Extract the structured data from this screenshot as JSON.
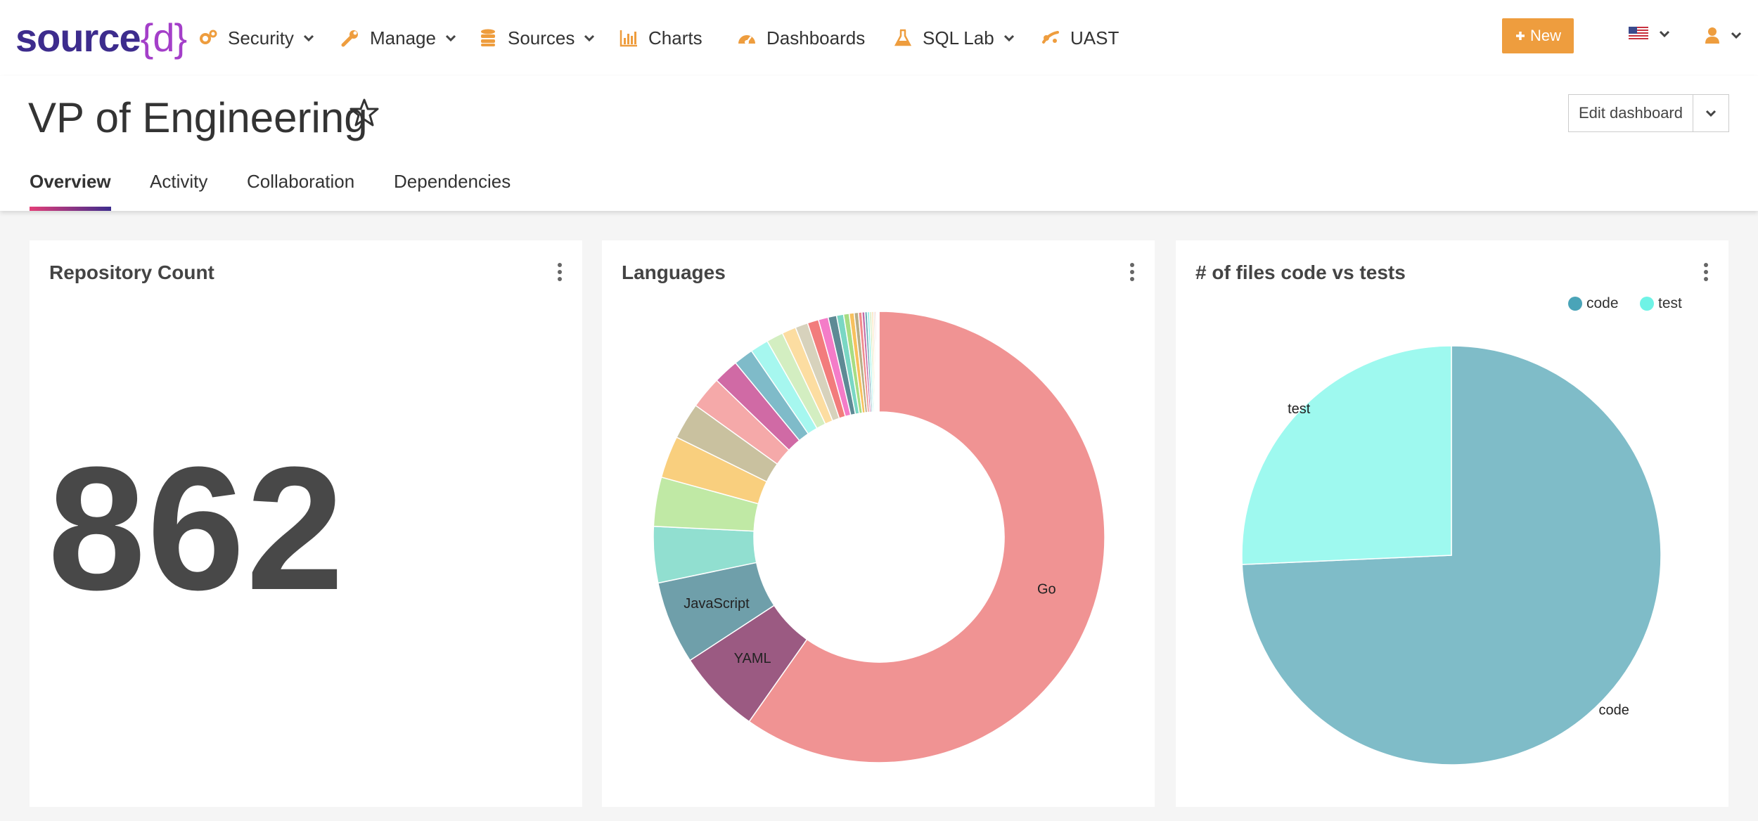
{
  "brand": {
    "logo_main": "source",
    "logo_left_brace": "{",
    "logo_letter": "d",
    "logo_right_brace": "}"
  },
  "nav": {
    "items": [
      {
        "label": "Security",
        "icon": "cogs-icon",
        "dropdown": true
      },
      {
        "label": "Manage",
        "icon": "wrench-icon",
        "dropdown": true
      },
      {
        "label": "Sources",
        "icon": "database-icon",
        "dropdown": true
      },
      {
        "label": "Charts",
        "icon": "bar-chart-icon",
        "dropdown": false
      },
      {
        "label": "Dashboards",
        "icon": "dashboard-gauge-icon",
        "dropdown": false
      },
      {
        "label": "SQL Lab",
        "icon": "flask-icon",
        "dropdown": true
      },
      {
        "label": "UAST",
        "icon": "tree-icon",
        "dropdown": false
      }
    ],
    "new_button": "New",
    "accent_color": "#ee9d3e"
  },
  "header": {
    "title": "VP of Engineering",
    "edit_button": "Edit dashboard",
    "tabs": [
      "Overview",
      "Activity",
      "Collaboration",
      "Dependencies"
    ],
    "active_tab": "Overview"
  },
  "cards": {
    "repo": {
      "title": "Repository Count",
      "value": "862"
    },
    "languages": {
      "title": "Languages"
    },
    "files": {
      "title": "# of files code vs tests"
    }
  },
  "chart_data": [
    {
      "type": "pie",
      "variant": "donut",
      "title": "Languages",
      "slices": [
        {
          "label": "Go",
          "value": 59.4,
          "color": "#f09393"
        },
        {
          "label": "YAML",
          "value": 6.0,
          "color": "#9b5a82"
        },
        {
          "label": "JavaScript",
          "value": 5.9,
          "color": "#6f9faa"
        },
        {
          "label": "",
          "value": 4.0,
          "color": "#91dfd0"
        },
        {
          "label": "",
          "value": 3.5,
          "color": "#c0e9a5"
        },
        {
          "label": "",
          "value": 3.0,
          "color": "#f9cf7e"
        },
        {
          "label": "",
          "value": 2.6,
          "color": "#c9c19f"
        },
        {
          "label": "",
          "value": 2.3,
          "color": "#f5a9a9"
        },
        {
          "label": "",
          "value": 1.8,
          "color": "#d06aa5"
        },
        {
          "label": "",
          "value": 1.4,
          "color": "#7fbbc9"
        },
        {
          "label": "",
          "value": 1.3,
          "color": "#a6f7ef"
        },
        {
          "label": "",
          "value": 1.2,
          "color": "#d3eec1"
        },
        {
          "label": "",
          "value": 1.0,
          "color": "#fcdda1"
        },
        {
          "label": "",
          "value": 0.9,
          "color": "#d7d2bc"
        },
        {
          "label": "",
          "value": 0.8,
          "color": "#f27c7c"
        },
        {
          "label": "",
          "value": 0.7,
          "color": "#f47cc8"
        },
        {
          "label": "",
          "value": 0.6,
          "color": "#5e8a95"
        },
        {
          "label": "",
          "value": 0.5,
          "color": "#7ad7c4"
        },
        {
          "label": "",
          "value": 0.4,
          "color": "#a7dd84"
        },
        {
          "label": "",
          "value": 0.35,
          "color": "#f7c15e"
        },
        {
          "label": "",
          "value": 0.3,
          "color": "#b8ae86"
        },
        {
          "label": "",
          "value": 0.25,
          "color": "#f08c8c"
        },
        {
          "label": "",
          "value": 0.2,
          "color": "#c26aa8"
        },
        {
          "label": "",
          "value": 0.18,
          "color": "#6fa8b8"
        },
        {
          "label": "",
          "value": 0.16,
          "color": "#8ff0e8"
        },
        {
          "label": "",
          "value": 0.14,
          "color": "#cde8b5"
        },
        {
          "label": "",
          "value": 0.12,
          "color": "#fbd18d"
        },
        {
          "label": "",
          "value": 0.1,
          "color": "#ccc6ad"
        },
        {
          "label": "",
          "value": 0.09,
          "color": "#e56c6c"
        },
        {
          "label": "",
          "value": 0.08,
          "color": "#9cc7d1"
        },
        {
          "label": "",
          "value": 0.07,
          "color": "#b0e0a0"
        },
        {
          "label": "",
          "value": 0.06,
          "color": "#f3b87a"
        }
      ]
    },
    {
      "type": "pie",
      "title": "# of files code vs tests",
      "legend_position": "top-right",
      "slices": [
        {
          "label": "code",
          "value": 74.3,
          "color": "#7fbcc8",
          "legend_color": "#4aa4b8"
        },
        {
          "label": "test",
          "value": 25.7,
          "color": "#9ef9ef",
          "legend_color": "#6ff3e6"
        }
      ]
    }
  ]
}
